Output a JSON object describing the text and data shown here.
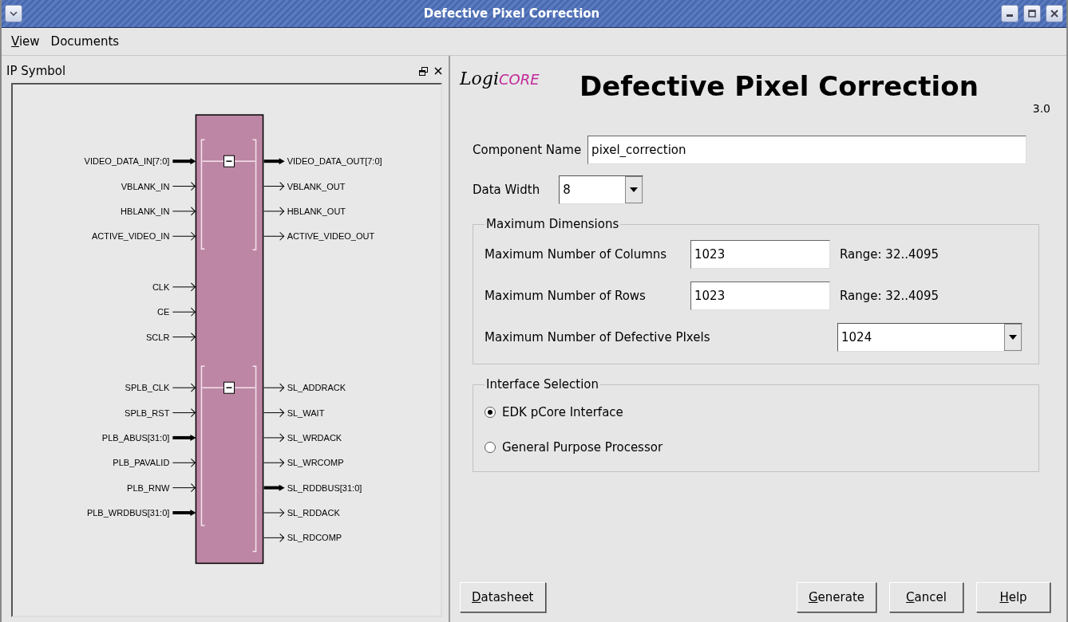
{
  "window": {
    "title": "Defective Pixel Correction"
  },
  "menu": [
    {
      "label": "View",
      "underline_first": true
    },
    {
      "label": "Documents",
      "underline_first": false
    }
  ],
  "ip_symbol": {
    "title": "IP Symbol",
    "sections": [
      {
        "kind": "group",
        "expanded": true,
        "inputs": [
          {
            "name": "VIDEO_DATA_IN[7:0]",
            "bus": true
          },
          {
            "name": "VBLANK_IN",
            "bus": false
          },
          {
            "name": "HBLANK_IN",
            "bus": false
          },
          {
            "name": "ACTIVE_VIDEO_IN",
            "bus": false
          }
        ],
        "outputs": [
          {
            "name": "VIDEO_DATA_OUT[7:0]",
            "bus": true
          },
          {
            "name": "VBLANK_OUT",
            "bus": false
          },
          {
            "name": "HBLANK_OUT",
            "bus": false
          },
          {
            "name": "ACTIVE_VIDEO_OUT",
            "bus": false
          }
        ]
      },
      {
        "kind": "single",
        "inputs": [
          {
            "name": "CLK",
            "bus": false
          },
          {
            "name": "CE",
            "bus": false
          },
          {
            "name": "SCLR",
            "bus": false
          }
        ]
      },
      {
        "kind": "group",
        "expanded": true,
        "inputs": [
          {
            "name": "SPLB_CLK",
            "bus": false
          },
          {
            "name": "SPLB_RST",
            "bus": false
          },
          {
            "name": "PLB_ABUS[31:0]",
            "bus": true
          },
          {
            "name": "PLB_PAVALID",
            "bus": false
          },
          {
            "name": "PLB_RNW",
            "bus": false
          },
          {
            "name": "PLB_WRDBUS[31:0]",
            "bus": true
          }
        ],
        "outputs": [
          {
            "name": "SL_ADDRACK",
            "bus": false
          },
          {
            "name": "SL_WAIT",
            "bus": false
          },
          {
            "name": "SL_WRDACK",
            "bus": false
          },
          {
            "name": "SL_WRCOMP",
            "bus": false
          },
          {
            "name": "SL_RDDBUS[31:0]",
            "bus": true
          },
          {
            "name": "SL_RDDACK",
            "bus": false
          },
          {
            "name": "SL_RDCOMP",
            "bus": false
          }
        ]
      }
    ]
  },
  "header": {
    "logo_prefix": "Logi",
    "logo_suffix": "CORE",
    "title": "Defective Pixel Correction",
    "version": "3.0"
  },
  "component_name": {
    "label": "Component Name",
    "value": "pixel_correction"
  },
  "data_width": {
    "label": "Data Width",
    "value": "8"
  },
  "maximum_dimensions": {
    "title": "Maximum Dimensions",
    "rows": [
      {
        "kind": "input",
        "label": "Maximum Number of Columns",
        "value": "1023",
        "range": "Range: 32..4095"
      },
      {
        "kind": "input",
        "label": "Maximum Number of Rows",
        "value": "1023",
        "range": "Range: 32..4095"
      },
      {
        "kind": "select",
        "label": "Maximum Number of Defective PIxels",
        "value": "1024"
      }
    ]
  },
  "interface_selection": {
    "title": "Interface Selection",
    "options": [
      {
        "label": "EDK pCore Interface",
        "selected": true
      },
      {
        "label": "General Purpose Processor",
        "selected": false
      }
    ]
  },
  "buttons_left": [
    {
      "label": "Datasheet",
      "underline_first": true
    }
  ],
  "buttons_right": [
    {
      "label": "Generate",
      "underline_first": true
    },
    {
      "label": "Cancel",
      "underline_first": true
    },
    {
      "label": "Help",
      "underline_first": true
    }
  ]
}
